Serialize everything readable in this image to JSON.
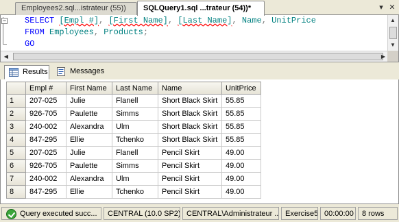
{
  "tabs": [
    {
      "label": "Employees2.sql...istrateur (55))",
      "active": false
    },
    {
      "label": "SQLQuery1.sql ...trateur (54))*",
      "active": true
    }
  ],
  "tab_controls": {
    "dropdown_icon": "dropdown-arrow-icon",
    "close_icon": "close-icon"
  },
  "query": {
    "line1": {
      "kw": "SELECT",
      "c1": "[Empl #]",
      "c2": "[First Name]",
      "c3": "[Last Name]",
      "c4": "Name",
      "c5": "UnitPrice"
    },
    "line2": {
      "kw": "FROM",
      "t1": "Employees",
      "t2": "Products"
    },
    "line3": {
      "kw": "GO"
    }
  },
  "result_tabs": {
    "results": "Results",
    "messages": "Messages"
  },
  "grid": {
    "columns": [
      "Empl #",
      "First Name",
      "Last Name",
      "Name",
      "UnitPrice"
    ],
    "rows": [
      [
        "1",
        "207-025",
        "Julie",
        "Flanell",
        "Short Black Skirt",
        "55.85"
      ],
      [
        "2",
        "926-705",
        "Paulette",
        "Simms",
        "Short Black Skirt",
        "55.85"
      ],
      [
        "3",
        "240-002",
        "Alexandra",
        "Ulm",
        "Short Black Skirt",
        "55.85"
      ],
      [
        "4",
        "847-295",
        "Ellie",
        "Tchenko",
        "Short Black Skirt",
        "55.85"
      ],
      [
        "5",
        "207-025",
        "Julie",
        "Flanell",
        "Pencil Skirt",
        "49.00"
      ],
      [
        "6",
        "926-705",
        "Paulette",
        "Simms",
        "Pencil Skirt",
        "49.00"
      ],
      [
        "7",
        "240-002",
        "Alexandra",
        "Ulm",
        "Pencil Skirt",
        "49.00"
      ],
      [
        "8",
        "847-295",
        "Ellie",
        "Tchenko",
        "Pencil Skirt",
        "49.00"
      ]
    ]
  },
  "status": {
    "message": "Query executed succ...",
    "server": "CENTRAL (10.0 SP2)",
    "user": "CENTRAL\\Administrateur ...",
    "database": "Exercise5",
    "time": "00:00:00",
    "rows": "8 rows",
    "success_color": "#3aa63a"
  }
}
